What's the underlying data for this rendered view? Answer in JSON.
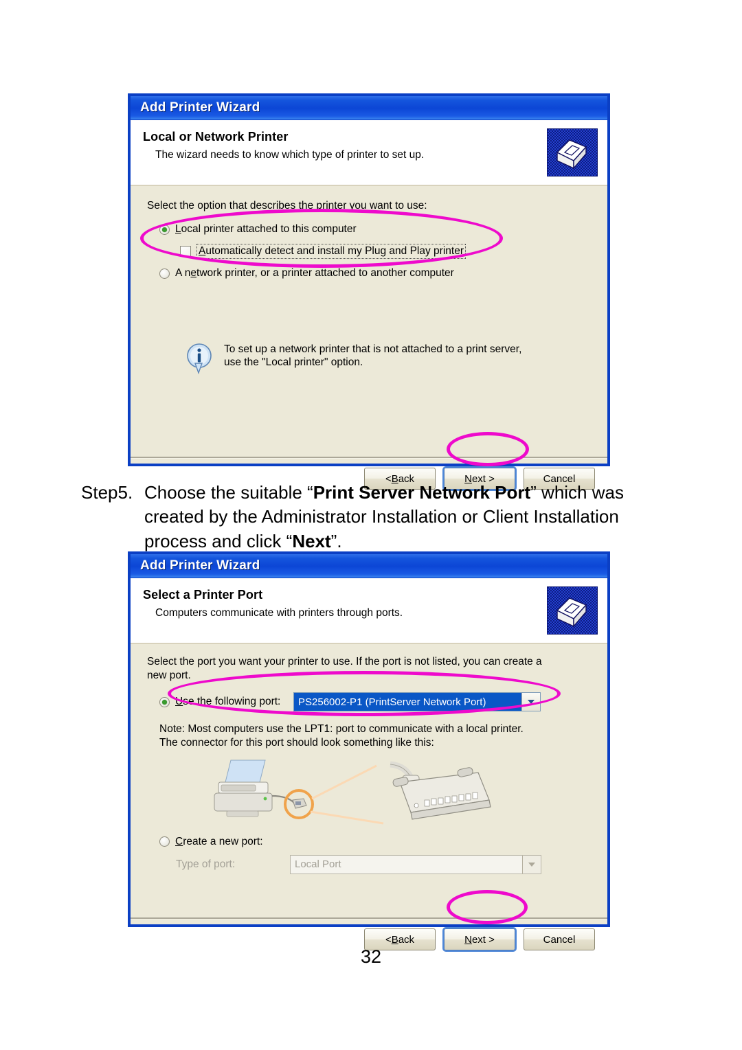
{
  "page": {
    "number": "32"
  },
  "instruction": {
    "step_label": "Step5.",
    "part1": "Choose the suitable “",
    "bold1": "Print Server Network Port",
    "part2": "” which was created by the Administrator Installation or Client Installation process and click “",
    "bold2": "Next",
    "part3": "”."
  },
  "colors": {
    "annotation": "#EE0ACC",
    "titlebar": "#0C46D6",
    "dialog_face": "#ECE9D8",
    "selection": "#0A57C6",
    "radio_dot": "#3A9B2E"
  },
  "dialog1": {
    "title": "Add Printer Wizard",
    "header_title": "Local or Network Printer",
    "header_sub": "The wizard needs to know which type of printer to set up.",
    "prompt": "Select the option that describes the printer you want to use:",
    "option_local": "Local printer attached to this computer",
    "option_local_accesskey": "L",
    "checkbox_autodetect": "Automatically detect and install my Plug and Play printer",
    "checkbox_autodetect_accesskey": "A",
    "checkbox_checked": false,
    "option_network": "A network printer, or a printer attached to another computer",
    "option_network_accesskey": "e",
    "selected_option": "option_local",
    "info_line1": "To set up a network printer that is not attached to a print server,",
    "info_line2": "use the \"Local printer\" option.",
    "buttons": {
      "back": "< Back",
      "back_accesskey": "B",
      "next": "Next >",
      "next_accesskey": "N",
      "cancel": "Cancel"
    }
  },
  "dialog2": {
    "title": "Add Printer Wizard",
    "header_title": "Select a Printer Port",
    "header_sub": "Computers communicate with printers through ports.",
    "prompt_line1": "Select the port you want your printer to use.  If the port is not listed, you can create a",
    "prompt_line2": "new port.",
    "option_use_port": "Use the following port:",
    "option_use_port_accesskey": "U",
    "port_value": "PS256002-P1 (PrintServer Network Port)",
    "note_line1": "Note: Most computers use the LPT1: port to communicate with a local printer.",
    "note_line2": "The connector for this port should look something like this:",
    "option_create_port": "Create a new port:",
    "option_create_port_accesskey": "C",
    "type_of_port_label": "Type of port:",
    "type_of_port_value": "Local Port",
    "selected_option": "option_use_port",
    "buttons": {
      "back": "< Back",
      "back_accesskey": "B",
      "next": "Next >",
      "next_accesskey": "N",
      "cancel": "Cancel"
    }
  }
}
